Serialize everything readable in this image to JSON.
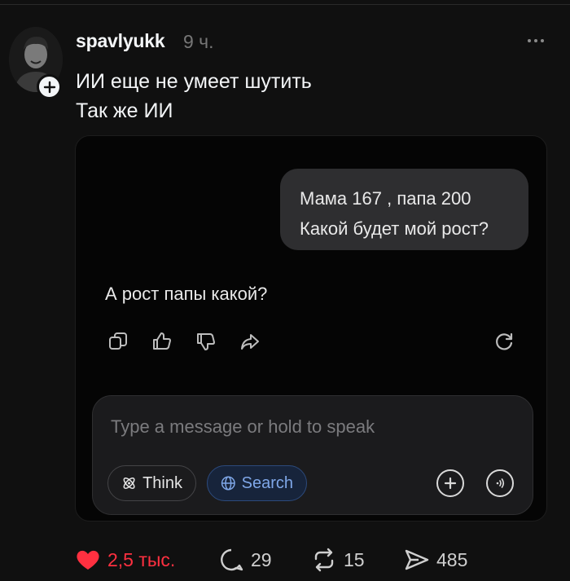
{
  "post": {
    "username": "spavlyukk",
    "time": "9 ч.",
    "lines": [
      "ИИ еще не умеет шутить",
      "Так же ИИ"
    ]
  },
  "chat": {
    "user_message": [
      "Мама 167 , папа 200",
      "Какой будет мой рост?"
    ],
    "ai_reply": "А рост папы какой?",
    "composer_placeholder": "Type a message or hold to speak",
    "think_label": "Think",
    "search_label": "Search"
  },
  "footer": {
    "likes": "2,5 тыс.",
    "replies": "29",
    "reposts": "15",
    "shares": "485"
  },
  "colors": {
    "background": "#101010",
    "like_red": "#ff3040",
    "search_blue": "#7fa7e8"
  },
  "icons": [
    "avatar",
    "plus-icon",
    "more-icon",
    "copy-icon",
    "thumbs-up-icon",
    "thumbs-down-icon",
    "share-arrow-icon",
    "regenerate-icon",
    "atom-icon",
    "globe-icon",
    "plus-circle-icon",
    "voice-icon",
    "heart-icon",
    "comment-icon",
    "repost-icon",
    "send-icon"
  ]
}
